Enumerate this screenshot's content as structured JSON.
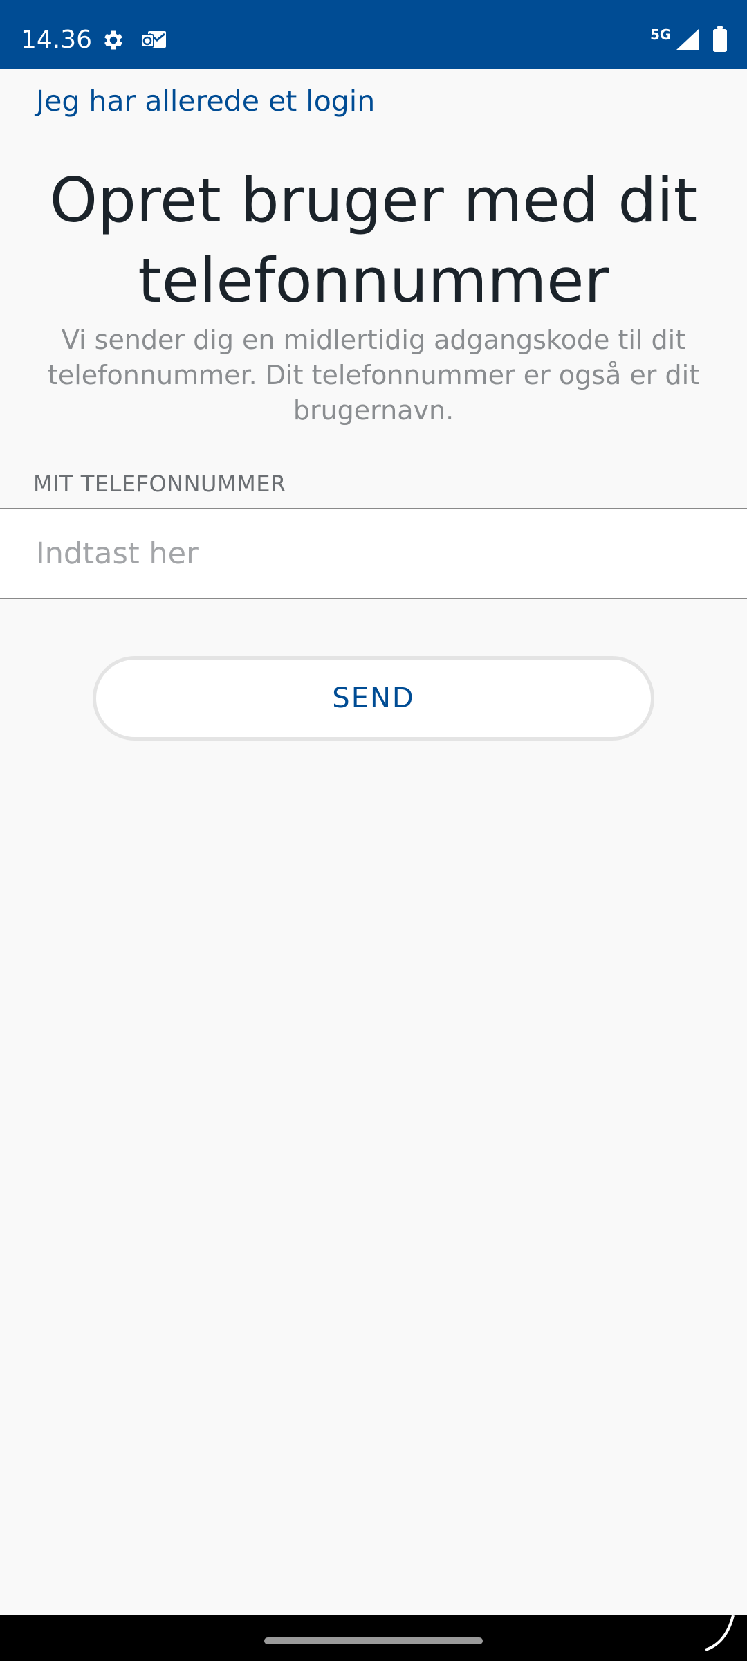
{
  "status_bar": {
    "time": "14.36",
    "network": "5G",
    "icons": [
      "gear-icon",
      "mail-notification-icon",
      "signal-icon",
      "battery-icon"
    ],
    "background_color": "#004c94"
  },
  "header": {
    "login_link": "Jeg har allerede et login"
  },
  "main": {
    "title": "Opret bruger med dit telefonnummer",
    "subtitle": "Vi sender dig en midlertidig adgangskode til dit telefonnummer. Dit telefonnummer er også er dit brugernavn.",
    "phone_field": {
      "label": "MIT TELEFONNUMMER",
      "value": "",
      "placeholder": "Indtast her"
    },
    "send_label": "SEND"
  },
  "colors": {
    "brand": "#004c94",
    "title_text": "#1b232a",
    "muted_text": "#8a8d90",
    "background": "#f9f9f9"
  }
}
